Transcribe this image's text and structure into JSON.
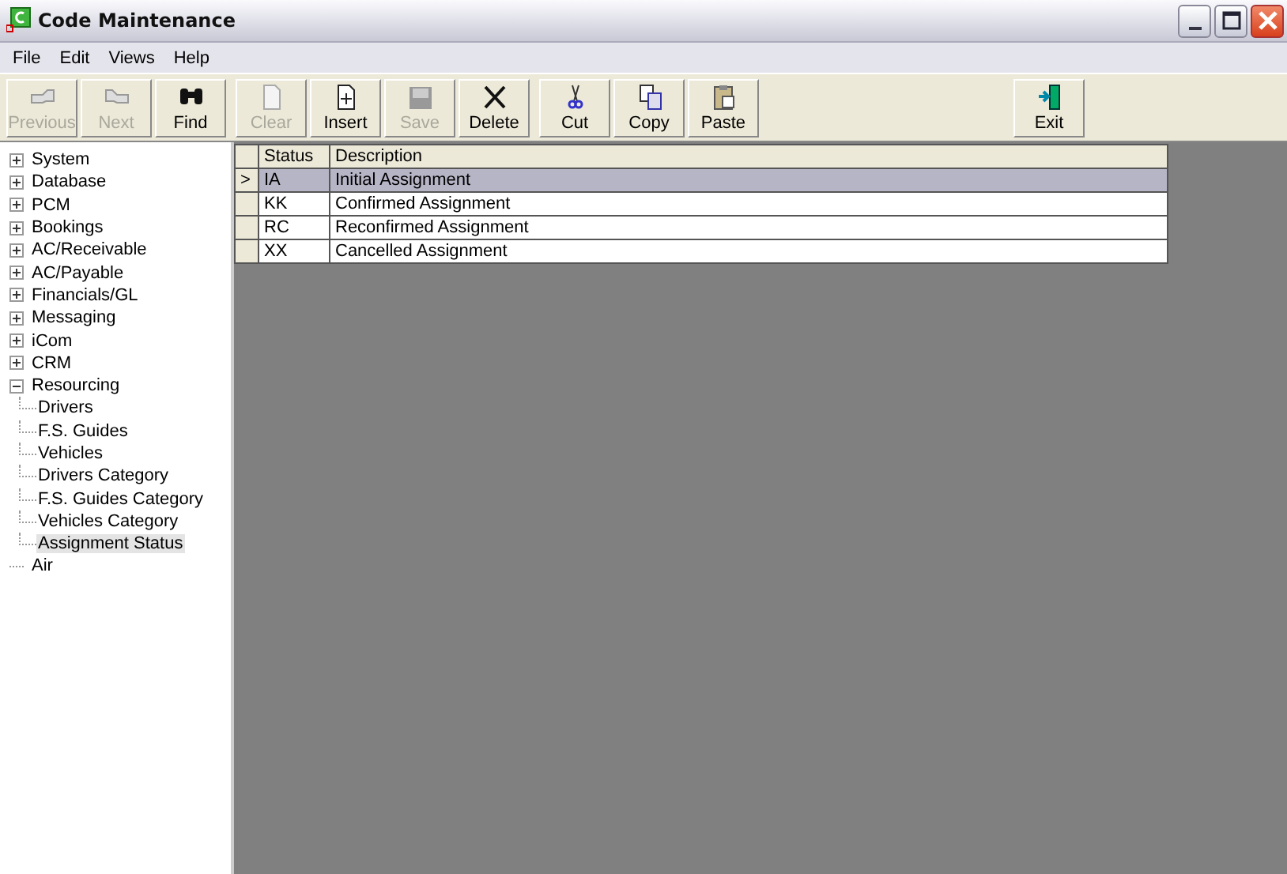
{
  "window": {
    "title": "Code Maintenance"
  },
  "menu": [
    "File",
    "Edit",
    "Views",
    "Help"
  ],
  "toolbar": [
    {
      "buttons": [
        {
          "label": "Previous",
          "disabled": true
        },
        {
          "label": "Next",
          "disabled": true
        },
        {
          "label": "Find",
          "disabled": false
        }
      ]
    },
    {
      "buttons": [
        {
          "label": "Clear",
          "disabled": true
        },
        {
          "label": "Insert",
          "disabled": false
        },
        {
          "label": "Save",
          "disabled": true
        },
        {
          "label": "Delete",
          "disabled": false
        }
      ]
    },
    {
      "buttons": [
        {
          "label": "Cut",
          "disabled": false
        },
        {
          "label": "Copy",
          "disabled": false
        },
        {
          "label": "Paste",
          "disabled": false
        }
      ]
    },
    {
      "buttons": [
        {
          "label": "Exit",
          "disabled": false
        }
      ]
    }
  ],
  "tree": [
    {
      "label": "System",
      "expanded": false,
      "selected": false
    },
    {
      "label": "Database",
      "expanded": false,
      "selected": false
    },
    {
      "label": "PCM",
      "expanded": false,
      "selected": false
    },
    {
      "label": "Bookings",
      "expanded": false,
      "selected": false
    },
    {
      "label": "AC/Receivable",
      "expanded": false,
      "selected": false
    },
    {
      "label": "AC/Payable",
      "expanded": false,
      "selected": false
    },
    {
      "label": "Financials/GL",
      "expanded": false,
      "selected": false
    },
    {
      "label": "Messaging",
      "expanded": false,
      "selected": false
    },
    {
      "label": "iCom",
      "expanded": false,
      "selected": false
    },
    {
      "label": "CRM",
      "expanded": false,
      "selected": false
    },
    {
      "label": "Resourcing",
      "expanded": true,
      "selected": false,
      "children": [
        {
          "label": "Drivers",
          "selected": false
        },
        {
          "label": "F.S. Guides",
          "selected": false
        },
        {
          "label": "Vehicles",
          "selected": false
        },
        {
          "label": "Drivers Category",
          "selected": false
        },
        {
          "label": "F.S. Guides Category",
          "selected": false
        },
        {
          "label": "Vehicles Category",
          "selected": false
        },
        {
          "label": "Assignment Status",
          "selected": true
        }
      ]
    },
    {
      "label": "Air",
      "selected": false
    }
  ],
  "table": {
    "columns": [
      "Status",
      "Description"
    ],
    "rows": [
      {
        "cells": [
          "IA",
          "Initial Assignment"
        ],
        "selected": true,
        "pointer": ">"
      },
      {
        "cells": [
          "KK",
          "Confirmed Assignment"
        ],
        "selected": false
      },
      {
        "cells": [
          "RC",
          "Reconfirmed Assignment"
        ],
        "selected": false
      },
      {
        "cells": [
          "XX",
          "Cancelled Assignment"
        ],
        "selected": false
      }
    ]
  }
}
